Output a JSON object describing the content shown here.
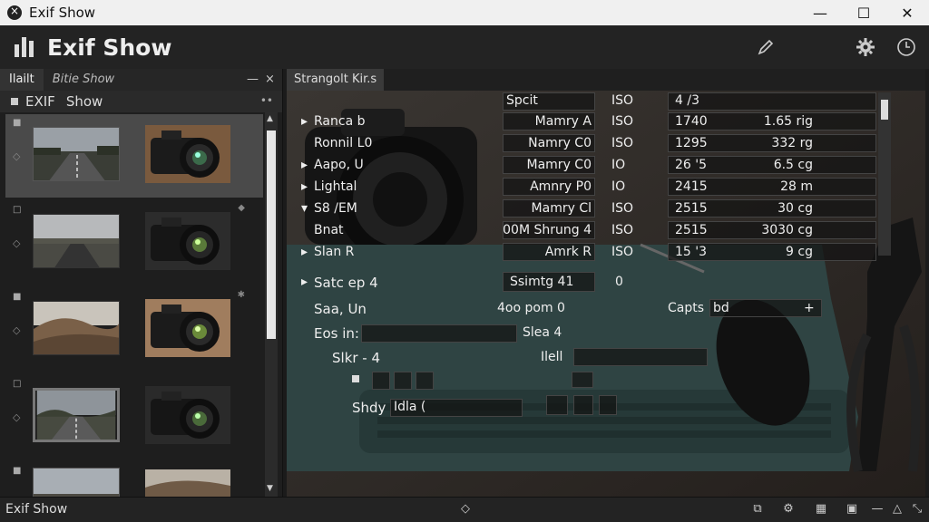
{
  "window": {
    "title": "Exif Show",
    "minimize": "—",
    "maximize": "☐",
    "close": "✕"
  },
  "header": {
    "title": "Exif Show",
    "pen_icon": "pencil-icon",
    "gear_icon": "gear-icon",
    "clock_icon": "clock-icon"
  },
  "left_panel": {
    "tabs": [
      "Ilailt",
      "Bitie Show"
    ],
    "minimize": "—",
    "close": "×",
    "subheader": {
      "label1": "EXIF",
      "label2": "Show",
      "dots": "••"
    }
  },
  "right_panel": {
    "tab": "Strangolt Kir.s",
    "header_row": {
      "name": "Spcit",
      "iso": "ISO",
      "value": "4 /3"
    },
    "rows": [
      {
        "arrow": "▸",
        "label": "Ranca b",
        "name": "Mamry A",
        "iso": "ISO",
        "num": "1740",
        "size": "1.65 rig"
      },
      {
        "arrow": "",
        "label": "Ronnil L0",
        "name": "Namry C0",
        "iso": "ISO",
        "num": "1295",
        "size": "332 rg"
      },
      {
        "arrow": "▸",
        "label": "Aapo, U",
        "name": "Mamry C0",
        "iso": "IO",
        "num": "26 '5",
        "size": "6.5 cg"
      },
      {
        "arrow": "▸",
        "label": "Lightal",
        "name": "Amnry P0",
        "iso": "IO",
        "num": "2415",
        "size": "28 m"
      },
      {
        "arrow": "▾",
        "label": "S8 /EM",
        "name": "Mamry Cl",
        "iso": "ISO",
        "num": "2515",
        "size": "30 cg"
      },
      {
        "arrow": "",
        "label": "Bnat",
        "name": "00M Shrung 4",
        "iso": "ISO",
        "num": "2515",
        "size": "3030 cg"
      },
      {
        "arrow": "▸",
        "label": "Slan R",
        "name": "Amrk R",
        "iso": "ISO",
        "num": "15 '3",
        "size": "9 cg"
      }
    ],
    "form": {
      "row1": {
        "arrow": "▸",
        "label": "Satc ep 4",
        "field": "Ssimtg 41",
        "value": "0"
      },
      "row2": {
        "label": "Saa, Un",
        "field": "4oo pom 0",
        "caps_label": "Capts",
        "caps_value": "bd",
        "caps_btn": "+"
      },
      "row3": {
        "label": "Eos in:",
        "field": "Slea 4"
      },
      "row4": {
        "label": "Slkr - 4",
        "field": "Ilell"
      },
      "row5": {
        "label": "Shdy",
        "value": "Idla  ("
      }
    }
  },
  "statusbar": {
    "title": "Exif Show",
    "center": "◇"
  }
}
